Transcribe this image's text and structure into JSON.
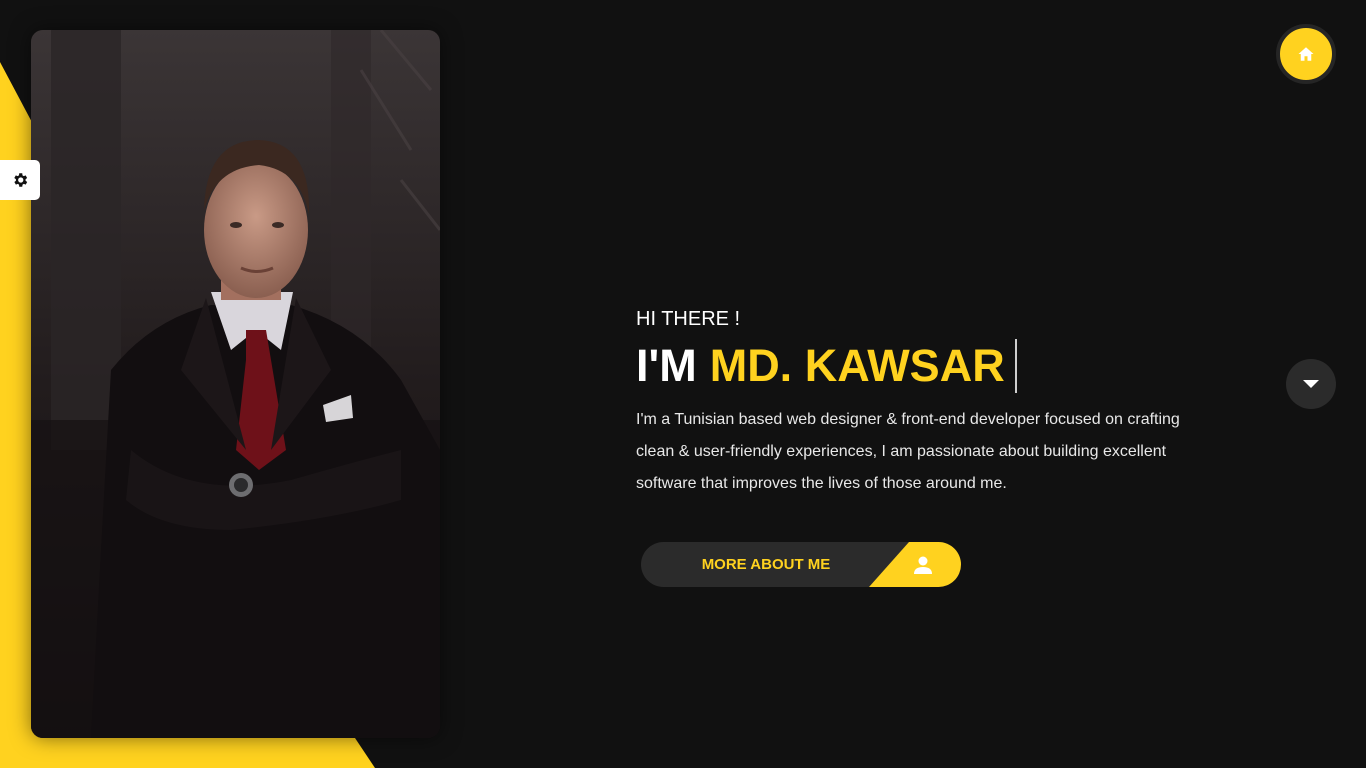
{
  "hero": {
    "greeting": "HI THERE !",
    "headline_prefix": "I'M",
    "headline_name": "MD. KAWSAR",
    "bio": "I'm a Tunisian based web designer & front-end developer focused on crafting clean & user-friendly experiences, I am passionate about building excellent software that improves the lives of those around me.",
    "cta_label": "MORE ABOUT ME"
  },
  "icons": {
    "settings": "gear-icon",
    "home": "home-icon",
    "scroll": "caret-down-icon",
    "cta": "user-icon"
  },
  "colors": {
    "accent": "#ffd21f",
    "background": "#111111",
    "button_dark": "#2b2b2b",
    "text": "#ffffff"
  }
}
